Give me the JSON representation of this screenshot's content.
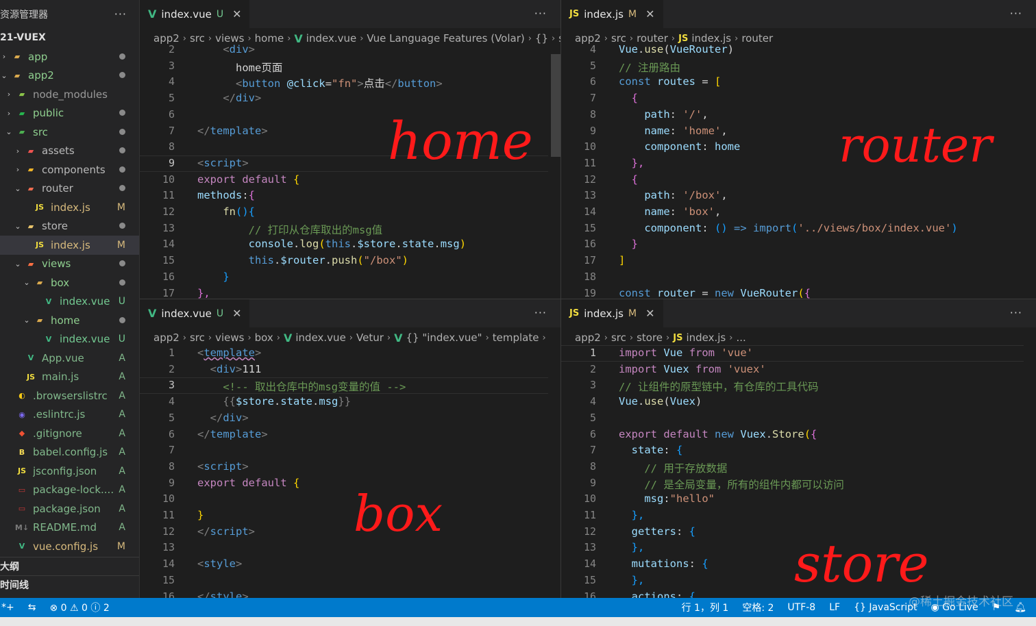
{
  "sidebar": {
    "title": "资源管理器",
    "more": "···",
    "project": "21-VUEX",
    "items": [
      {
        "label": "app",
        "indent": 0,
        "chev": "›",
        "icon": "folder-icon",
        "status": "dot",
        "color": "#8fcf8f"
      },
      {
        "label": "app2",
        "indent": 0,
        "chev": "⌄",
        "icon": "folder-icon",
        "status": "dot",
        "color": "#8fcf8f"
      },
      {
        "label": "node_modules",
        "indent": 1,
        "chev": "›",
        "icon": "node-folder-icon",
        "status": "",
        "color": "#9a9a9a"
      },
      {
        "label": "public",
        "indent": 1,
        "chev": "›",
        "icon": "public-folder-icon",
        "status": "dot",
        "color": "#8fcf8f"
      },
      {
        "label": "src",
        "indent": 1,
        "chev": "⌄",
        "icon": "src-folder-icon",
        "status": "dot",
        "color": "#8fcf8f"
      },
      {
        "label": "assets",
        "indent": 2,
        "chev": "›",
        "icon": "assets-folder-icon",
        "status": "dot",
        "color": "#b9b9b9"
      },
      {
        "label": "components",
        "indent": 2,
        "chev": "›",
        "icon": "components-folder-icon",
        "status": "dot",
        "color": "#b9b9b9"
      },
      {
        "label": "router",
        "indent": 2,
        "chev": "⌄",
        "icon": "router-folder-icon",
        "status": "dot",
        "color": "#b9b9b9"
      },
      {
        "label": "index.js",
        "indent": 3,
        "chev": "",
        "icon": "js-icon",
        "status": "M",
        "color": "#d7ba7d"
      },
      {
        "label": "store",
        "indent": 2,
        "chev": "⌄",
        "icon": "store-folder-icon",
        "status": "dot",
        "color": "#b9b9b9"
      },
      {
        "label": "index.js",
        "indent": 3,
        "chev": "",
        "icon": "js-icon",
        "status": "M",
        "color": "#d7ba7d",
        "selected": true
      },
      {
        "label": "views",
        "indent": 2,
        "chev": "⌄",
        "icon": "views-folder-icon",
        "status": "dot",
        "color": "#8fcf8f"
      },
      {
        "label": "box",
        "indent": 3,
        "chev": "⌄",
        "icon": "folder-icon",
        "status": "dot",
        "color": "#8fcf8f"
      },
      {
        "label": "index.vue",
        "indent": 4,
        "chev": "",
        "icon": "vue-icon",
        "status": "U",
        "color": "#73c991"
      },
      {
        "label": "home",
        "indent": 3,
        "chev": "⌄",
        "icon": "folder-icon",
        "status": "dot",
        "color": "#8fcf8f"
      },
      {
        "label": "index.vue",
        "indent": 4,
        "chev": "",
        "icon": "vue-icon",
        "status": "U",
        "color": "#73c991"
      },
      {
        "label": "App.vue",
        "indent": 2,
        "chev": "",
        "icon": "vue-icon",
        "status": "A",
        "color": "#81b88b"
      },
      {
        "label": "main.js",
        "indent": 2,
        "chev": "",
        "icon": "js-icon",
        "status": "A",
        "color": "#81b88b"
      },
      {
        "label": ".browserslistrc",
        "indent": 1,
        "chev": "",
        "icon": "browserslist-icon",
        "status": "A",
        "color": "#81b88b"
      },
      {
        "label": ".eslintrc.js",
        "indent": 1,
        "chev": "",
        "icon": "eslint-icon",
        "status": "A",
        "color": "#81b88b"
      },
      {
        "label": ".gitignore",
        "indent": 1,
        "chev": "",
        "icon": "git-icon",
        "status": "A",
        "color": "#81b88b"
      },
      {
        "label": "babel.config.js",
        "indent": 1,
        "chev": "",
        "icon": "babel-icon",
        "status": "A",
        "color": "#81b88b"
      },
      {
        "label": "jsconfig.json",
        "indent": 1,
        "chev": "",
        "icon": "js-icon",
        "status": "A",
        "color": "#81b88b"
      },
      {
        "label": "package-lock....",
        "indent": 1,
        "chev": "",
        "icon": "npm-icon",
        "status": "A",
        "color": "#81b88b"
      },
      {
        "label": "package.json",
        "indent": 1,
        "chev": "",
        "icon": "npm-icon",
        "status": "A",
        "color": "#81b88b"
      },
      {
        "label": "README.md",
        "indent": 1,
        "chev": "",
        "icon": "markdown-icon",
        "status": "A",
        "color": "#81b88b"
      },
      {
        "label": "vue.config.js",
        "indent": 1,
        "chev": "",
        "icon": "vue-config-icon",
        "status": "M",
        "color": "#d7ba7d"
      }
    ],
    "outline": "大纲",
    "timeline": "时间线"
  },
  "panes": {
    "home": {
      "tab": {
        "name": "index.vue",
        "status": "U",
        "close": "✕"
      },
      "more": "···",
      "crumbs": [
        "app2",
        "src",
        "views",
        "home",
        "index.vue",
        "Vue Language Features (Volar)",
        "{}",
        "s"
      ],
      "annotation": "home",
      "lines": [
        {
          "n": "2",
          "html": "    <span class='t'>&lt;</span><span class='tg'>div</span><span class='t'>&gt;</span>"
        },
        {
          "n": "3",
          "html": "      home页面"
        },
        {
          "n": "4",
          "html": "      <span class='t'>&lt;</span><span class='tg'>button</span> <span class='cv'>@click</span>=<span class='cs'>\"fn\"</span><span class='t'>&gt;</span>点击<span class='t'>&lt;/</span><span class='tg'>button</span><span class='t'>&gt;</span>"
        },
        {
          "n": "5",
          "html": "    <span class='t'>&lt;/</span><span class='tg'>div</span><span class='t'>&gt;</span>"
        },
        {
          "n": "6",
          "html": ""
        },
        {
          "n": "7",
          "html": "<span class='t'>&lt;/</span><span class='tg'>template</span><span class='t'>&gt;</span>"
        },
        {
          "n": "8",
          "html": ""
        },
        {
          "n": "9",
          "html": "<span class='t'>&lt;</span><span class='tg'>script</span><span class='t'>&gt;</span>",
          "cur": true
        },
        {
          "n": "10",
          "html": "<span class='ck'>export</span> <span class='ck'>default</span> <span class='cb'>{</span>"
        },
        {
          "n": "11",
          "html": "<span class='cv'>methods</span>:<span class='cp'>{</span>"
        },
        {
          "n": "12",
          "html": "    <span class='cf'>fn</span><span class='cl2'>(){</span>"
        },
        {
          "n": "13",
          "html": "        <span class='cc'>// 打印从仓库取出的msg值</span>"
        },
        {
          "n": "14",
          "html": "        <span class='cv'>console</span>.<span class='cf'>log</span><span class='cb'>(</span><span class='tg'>this</span>.<span class='cv'>$store</span>.<span class='cv'>state</span>.<span class='cv'>msg</span><span class='cb'>)</span>"
        },
        {
          "n": "15",
          "html": "        <span class='tg'>this</span>.<span class='cv'>$router</span>.<span class='cf'>push</span><span class='cb'>(</span><span class='cs'>\"/box\"</span><span class='cb'>)</span>"
        },
        {
          "n": "16",
          "html": "    <span class='cl2'>}</span>"
        },
        {
          "n": "17",
          "html": "<span class='cp'>},</span>"
        }
      ]
    },
    "router": {
      "tab": {
        "name": "index.js",
        "status": "M",
        "close": "✕"
      },
      "more": "···",
      "crumbs": [
        "app2",
        "src",
        "router",
        "index.js",
        "router"
      ],
      "annotation": "router",
      "lines": [
        {
          "n": "4",
          "html": "<span class='cv'>Vue</span>.<span class='cf'>use</span>(<span class='cv'>VueRouter</span>)"
        },
        {
          "n": "5",
          "html": "<span class='cc'>// 注册路由</span>"
        },
        {
          "n": "6",
          "html": "<span class='tg'>const</span> <span class='cv'>routes</span> = <span class='cb'>[</span>"
        },
        {
          "n": "7",
          "html": "  <span class='cp'>{</span>"
        },
        {
          "n": "8",
          "html": "    <span class='cv'>path</span>: <span class='cs'>'/'</span>,"
        },
        {
          "n": "9",
          "html": "    <span class='cv'>name</span>: <span class='cs'>'home'</span>,"
        },
        {
          "n": "10",
          "html": "    <span class='cv'>component</span>: <span class='cv'>home</span>"
        },
        {
          "n": "11",
          "html": "  <span class='cp'>},</span>"
        },
        {
          "n": "12",
          "html": "  <span class='cp'>{</span>"
        },
        {
          "n": "13",
          "html": "    <span class='cv'>path</span>: <span class='cs'>'/box'</span>,"
        },
        {
          "n": "14",
          "html": "    <span class='cv'>name</span>: <span class='cs'>'box'</span>,"
        },
        {
          "n": "15",
          "html": "    <span class='cv'>component</span>: <span class='cl2'>()</span> <span class='tg'>=&gt;</span> <span class='tg'>import</span><span class='cl2'>(</span><span class='cs'>'../views/box/index.vue'</span><span class='cl2'>)</span>"
        },
        {
          "n": "16",
          "html": "  <span class='cp'>}</span>"
        },
        {
          "n": "17",
          "html": "<span class='cb'>]</span>"
        },
        {
          "n": "18",
          "html": ""
        },
        {
          "n": "19",
          "html": "<span class='tg'>const</span> <span class='cv'>router</span> = <span class='tg'>new</span> <span class='cv'>VueRouter</span><span class='cb'>(</span><span class='cp'>{</span>"
        }
      ]
    },
    "box": {
      "tab": {
        "name": "index.vue",
        "status": "U",
        "close": "✕"
      },
      "more": "···",
      "crumbs": [
        "app2",
        "src",
        "views",
        "box",
        "index.vue",
        "Vetur",
        "{} \"index.vue\"",
        "template",
        ""
      ],
      "annotation": "box",
      "lines": [
        {
          "n": "1",
          "html": "<span class='t'>&lt;</span><span class='tg' style='text-decoration:underline wavy #c586c0'>template</span><span class='t'>&gt;</span>"
        },
        {
          "n": "2",
          "html": "  <span class='t'>&lt;</span><span class='tg'>div</span><span class='t'>&gt;</span>111"
        },
        {
          "n": "3",
          "html": "    <span class='cc'>&lt;!-- 取出仓库中的msg变量的值 --&gt;</span>",
          "cur": true
        },
        {
          "n": "4",
          "html": "    <span class='t'>{{</span><span class='cv'>$store</span>.<span class='cv'>state</span>.<span class='cv'>msg</span><span class='t'>}}</span>"
        },
        {
          "n": "5",
          "html": "  <span class='t'>&lt;/</span><span class='tg'>div</span><span class='t'>&gt;</span>"
        },
        {
          "n": "6",
          "html": "<span class='t'>&lt;/</span><span class='tg'>template</span><span class='t'>&gt;</span>"
        },
        {
          "n": "7",
          "html": ""
        },
        {
          "n": "8",
          "html": "<span class='t'>&lt;</span><span class='tg'>script</span><span class='t'>&gt;</span>"
        },
        {
          "n": "9",
          "html": "<span class='ck'>export</span> <span class='ck'>default</span> <span class='cb'>{</span>"
        },
        {
          "n": "10",
          "html": ""
        },
        {
          "n": "11",
          "html": "<span class='cb'>}</span>"
        },
        {
          "n": "12",
          "html": "<span class='t'>&lt;/</span><span class='tg'>script</span><span class='t'>&gt;</span>"
        },
        {
          "n": "13",
          "html": ""
        },
        {
          "n": "14",
          "html": "<span class='t'>&lt;</span><span class='tg'>style</span><span class='t'>&gt;</span>"
        },
        {
          "n": "15",
          "html": ""
        },
        {
          "n": "16",
          "html": "<span class='t'>&lt;/</span><span class='tg'>style</span><span class='t'>&gt;</span>"
        }
      ]
    },
    "store": {
      "tab": {
        "name": "index.js",
        "status": "M",
        "close": "✕"
      },
      "more": "···",
      "crumbs": [
        "app2",
        "src",
        "store",
        "index.js",
        "..."
      ],
      "annotation": "store",
      "lines": [
        {
          "n": "1",
          "html": "<span class='ck'>import</span> <span class='cv'>Vue</span> <span class='ck'>from</span> <span class='cs'>'vue'</span>",
          "cur": true
        },
        {
          "n": "2",
          "html": "<span class='ck'>import</span> <span class='cv'>Vuex</span> <span class='ck'>from</span> <span class='cs'>'vuex'</span>"
        },
        {
          "n": "3",
          "html": "<span class='cc'>// 让组件的原型链中，有仓库的工具代码</span>"
        },
        {
          "n": "4",
          "html": "<span class='cv'>Vue</span>.<span class='cf'>use</span>(<span class='cv'>Vuex</span>)"
        },
        {
          "n": "5",
          "html": ""
        },
        {
          "n": "6",
          "html": "<span class='ck'>export</span> <span class='ck'>default</span> <span class='tg'>new</span> <span class='cv'>Vuex</span>.<span class='cf'>Store</span><span class='cb'>(</span><span class='cp'>{</span>"
        },
        {
          "n": "7",
          "html": "  <span class='cv'>state</span>: <span class='cl2'>{</span>"
        },
        {
          "n": "8",
          "html": "    <span class='cc'>// 用于存放数据</span>"
        },
        {
          "n": "9",
          "html": "    <span class='cc'>// 是全局变量，所有的组件内都可以访问</span>"
        },
        {
          "n": "10",
          "html": "    <span class='cv'>msg</span>:<span class='cs'>\"hello\"</span>"
        },
        {
          "n": "11",
          "html": "  <span class='cl2'>},</span>"
        },
        {
          "n": "12",
          "html": "  <span class='cv'>getters</span>: <span class='cl2'>{</span>"
        },
        {
          "n": "13",
          "html": "  <span class='cl2'>},</span>"
        },
        {
          "n": "14",
          "html": "  <span class='cv'>mutations</span>: <span class='cl2'>{</span>"
        },
        {
          "n": "15",
          "html": "  <span class='cl2'>},</span>"
        },
        {
          "n": "16",
          "html": "  <span class='cv'>actions</span>: <span class='cl2'>{</span>"
        }
      ]
    }
  },
  "status": {
    "left_icon": "*+",
    "remote": "⇆",
    "problems": "⊗ 0 ⚠ 0 ⓘ 2",
    "position": "行 1，列 1",
    "spaces": "空格: 2",
    "encoding": "UTF-8",
    "eol": "LF",
    "language": "{} JavaScript",
    "golive": "Go Live",
    "watermark": "@稀土掘金技术社区"
  }
}
